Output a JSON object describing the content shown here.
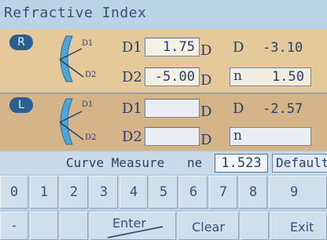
{
  "title": "Refractive Index",
  "right": {
    "badge": "R",
    "d1_label": "D1",
    "d2_label": "D2",
    "lens_d1": "D1",
    "lens_d2": "D2",
    "d1_value": "1.75",
    "d2_value": "-5.00",
    "unit": "D",
    "d_label": "D",
    "d_value": "-3.10",
    "n_label": "n",
    "n_value": "1.50"
  },
  "left": {
    "badge": "L",
    "d1_label": "D1",
    "d2_label": "D2",
    "lens_d1": "D1",
    "lens_d2": "D2",
    "d1_value": "",
    "d2_value": "",
    "unit": "D",
    "d_label": "D",
    "d_value": "-2.57",
    "n_label": "n",
    "n_value": ""
  },
  "curve": {
    "label": "Curve Measure",
    "ne_label": "ne",
    "ne_value": "1.523",
    "default_label": "Default"
  },
  "keypad": [
    "0",
    "1",
    "2",
    "3",
    "4",
    "5",
    "6",
    "7",
    "8",
    "9"
  ],
  "bottom": {
    "minus": "-",
    "enter": "Enter",
    "clear": "Clear",
    "exit": "Exit"
  }
}
